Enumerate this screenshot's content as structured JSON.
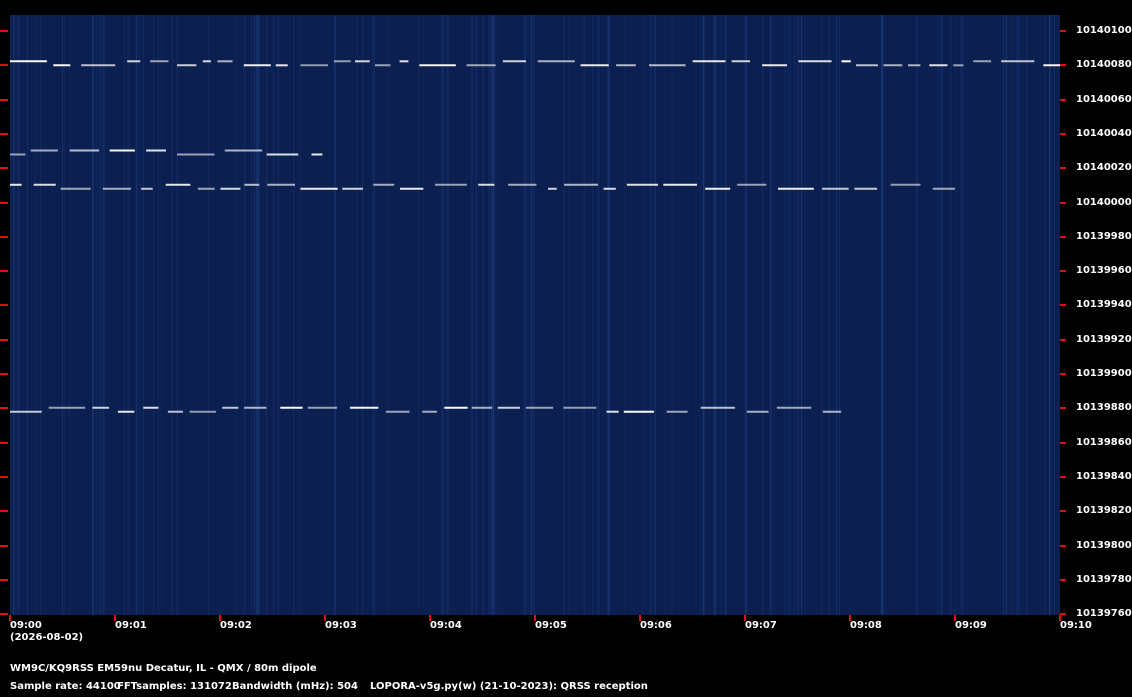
{
  "y_axis_labels": [
    "10140100",
    "10140080",
    "10140060",
    "10140040",
    "10140020",
    "10140000",
    "10139980",
    "10139960",
    "10139940",
    "10139920",
    "10139900",
    "10139880",
    "10139860",
    "10139840",
    "10139820",
    "10139800",
    "10139780",
    "10139760"
  ],
  "x_axis_labels": [
    "09:00",
    "09:01",
    "09:02",
    "09:03",
    "09:04",
    "09:05",
    "09:06",
    "09:07",
    "09:08",
    "09:09",
    "09:10"
  ],
  "date_label": "(2026-08-02)",
  "station_info": "WM9C/KQ9RSS EM59nu Decatur, IL - QMX / 80m dipole",
  "sample_rate": "Sample rate: 44100",
  "fft_samples": "FFTsamples: 131072",
  "bandwidth": "Bandwidth (mHz): 504",
  "software": "LOPORA-v5g.py(w) (21-10-2023): QRSS reception",
  "colors": {
    "background": "#0b1f50",
    "signal": "#ffffff",
    "tick": "#e01010"
  },
  "chart_data": {
    "type": "heatmap",
    "xlabel": "",
    "ylabel": "",
    "x_range": [
      "09:00",
      "09:10"
    ],
    "y_range_hz": [
      10139760,
      10140100
    ],
    "signals": [
      {
        "freq_hz": 10140080,
        "start": "09:00",
        "end": "09:10"
      },
      {
        "freq_hz": 10140028,
        "start": "09:00",
        "end": "09:03"
      },
      {
        "freq_hz": 10140008,
        "start": "09:00",
        "end": "09:09"
      },
      {
        "freq_hz": 10139878,
        "start": "09:00",
        "end": "09:08"
      }
    ]
  }
}
